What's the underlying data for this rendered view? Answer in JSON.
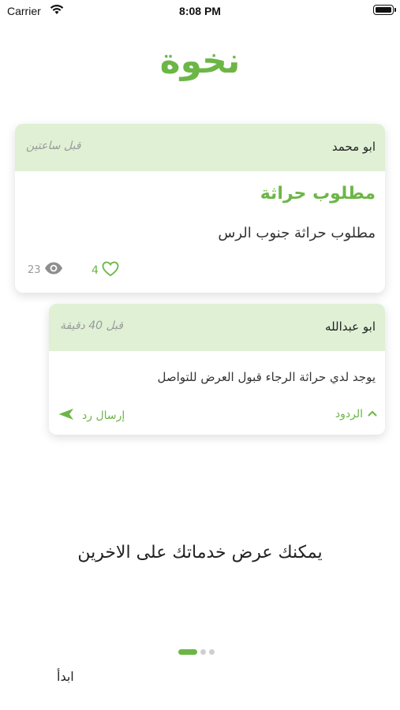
{
  "status_bar": {
    "carrier": "Carrier",
    "time": "8:08 PM"
  },
  "app": {
    "title": "نخوة"
  },
  "post": {
    "author": "ابو محمد",
    "time_ago": "قبل ساعتين",
    "title": "مطلوب حراثة",
    "body": "مطلوب حراثة جنوب الرس",
    "likes": "4",
    "views": "23",
    "icons": {
      "like": "heart-icon",
      "views": "eye-icon"
    }
  },
  "reply": {
    "author": "ابو عبدالله",
    "time_ago": "قبل 40 دقيقة",
    "body": "يوجد لدي حراثة الرجاء قبول العرض للتواصل",
    "replies_label": "الردود",
    "send_label": "إرسال رد",
    "icons": {
      "replies": "chevron-up-icon",
      "send": "send-icon"
    }
  },
  "onboarding": {
    "tagline": "يمكنك عرض خدماتك على الاخرين",
    "page_count": 3,
    "current_page": 1,
    "start_label": "ابدأ"
  },
  "colors": {
    "accent": "#6cb646",
    "header_bg": "#dff0d5",
    "muted": "#9a9a9a"
  }
}
